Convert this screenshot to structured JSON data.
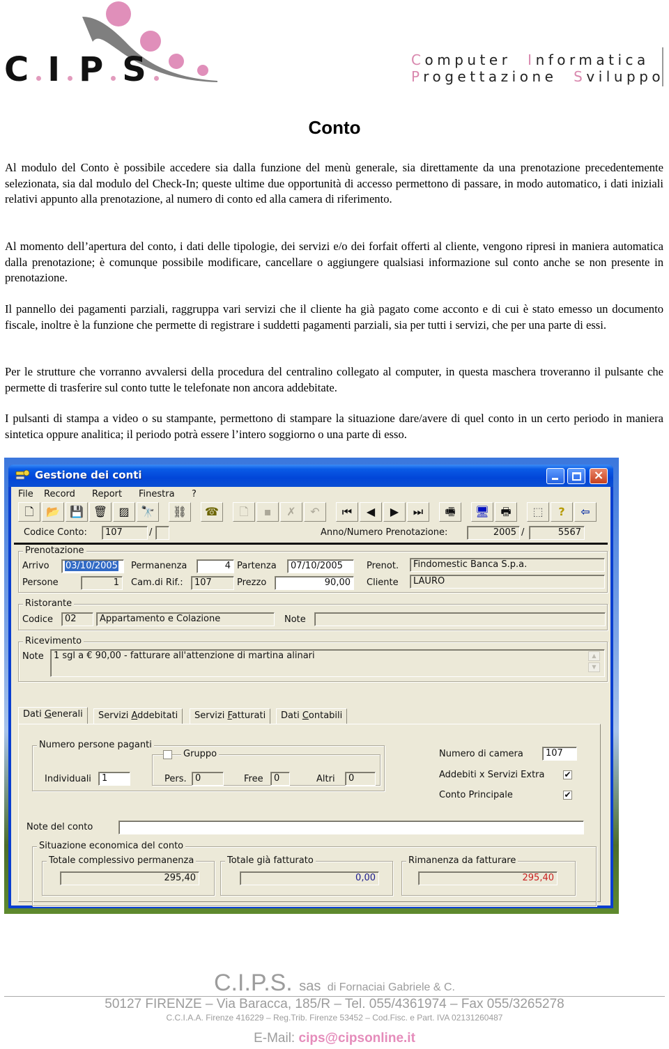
{
  "letterhead": {
    "logo_letters": [
      "C",
      "I",
      "P",
      "S"
    ],
    "tagline_line1": [
      {
        "cap": "C",
        "rest": "omputer"
      },
      {
        "cap": "I",
        "rest": "nformatica"
      }
    ],
    "tagline_line2": [
      {
        "cap": "P",
        "rest": "rogettazione"
      },
      {
        "cap": "S",
        "rest": "viluppo"
      }
    ],
    "brand_pink": "#d988ae"
  },
  "document": {
    "title": "Conto",
    "paragraphs": [
      "Al modulo del Conto è possibile accedere sia dalla funzione del menù generale, sia direttamente da una prenotazione precedentemente selezionata, sia dal modulo del Check-In; queste ultime due opportunità di accesso permettono di passare, in modo automatico, i dati iniziali relativi appunto alla prenotazione, al numero di conto ed alla camera di riferimento.",
      "Al momento dell’apertura del conto, i dati delle tipologie, dei servizi e/o dei forfait offerti al cliente, vengono ripresi in maniera automatica dalla prenotazione; è comunque possibile modificare, cancellare o aggiungere qualsiasi informazione sul conto anche se non presente in prenotazione.",
      "Il pannello dei pagamenti parziali, raggruppa vari servizi che il cliente ha già pagato come acconto e di cui è stato emesso un documento fiscale, inoltre è la funzione che permette di registrare i suddetti pagamenti parziali, sia per tutti i servizi, che per una parte di essi.",
      "Per le strutture che vorranno avvalersi della procedura del centralino collegato al computer,  in questa maschera troveranno il pulsante che permette di trasferire sul conto tutte le telefonate non ancora addebitate.",
      "I pulsanti di stampa a video o su stampante, permettono di stampare la situazione dare/avere di quel conto in un certo periodo in maniera sintetica oppure analitica; il periodo potrà essere l’intero soggiorno o una parte di esso."
    ]
  },
  "window": {
    "title": "Gestione dei conti",
    "controls": {
      "minimize": "minimize",
      "maximize": "maximize",
      "close": "×"
    },
    "menu": [
      "File",
      "Record",
      "Report",
      "Finestra",
      "?"
    ],
    "toolbar": [
      {
        "icon": "new-document-icon",
        "glyph": "🗋",
        "enabled": true
      },
      {
        "icon": "open-folder-icon",
        "glyph": "📂",
        "enabled": true
      },
      {
        "icon": "save-icon",
        "glyph": "💾",
        "enabled": true
      },
      {
        "icon": "trash-icon",
        "glyph": "🗑",
        "enabled": true
      },
      {
        "icon": "hatch-filter-icon",
        "glyph": "▨",
        "enabled": true
      },
      {
        "icon": "binoculars-icon",
        "glyph": "🔭",
        "enabled": true
      },
      {
        "icon": "unlink-chain-icon",
        "glyph": "⛓",
        "enabled": true
      },
      {
        "icon": "telephone-icon",
        "glyph": "☎",
        "enabled": true
      },
      {
        "icon": "new-line-icon",
        "glyph": "🗋",
        "enabled": false
      },
      {
        "icon": "save-line-icon",
        "glyph": "▪",
        "enabled": false
      },
      {
        "icon": "delete-line-icon",
        "glyph": "✗",
        "enabled": false
      },
      {
        "icon": "undo-line-icon",
        "glyph": "↶",
        "enabled": false
      },
      {
        "icon": "first-record-icon",
        "glyph": "⏮",
        "enabled": true
      },
      {
        "icon": "previous-record-icon",
        "glyph": "◀",
        "enabled": true
      },
      {
        "icon": "next-record-icon",
        "glyph": "▶",
        "enabled": true
      },
      {
        "icon": "last-record-icon",
        "glyph": "⏭",
        "enabled": true
      },
      {
        "icon": "fax-printer-icon",
        "glyph": "🖷",
        "enabled": true
      },
      {
        "icon": "monitor-icon",
        "glyph": "🖥",
        "enabled": true
      },
      {
        "icon": "printer-icon",
        "glyph": "🖶",
        "enabled": true
      },
      {
        "icon": "select-area-icon",
        "glyph": "⬚",
        "enabled": true
      },
      {
        "icon": "help-icon",
        "glyph": "?",
        "enabled": true
      },
      {
        "icon": "exit-door-icon",
        "glyph": "⇦",
        "enabled": true
      }
    ],
    "header": {
      "codice_conto_label": "Codice Conto:",
      "codice_conto_value": "107",
      "codice_conto_suffix": "",
      "slash": "/",
      "anno_label": "Anno/Numero Prenotazione:",
      "anno_value": "2005",
      "numero_value": "5567"
    },
    "prenotazione": {
      "title": "Prenotazione",
      "arrivo_label": "Arrivo",
      "arrivo_value": "03/10/2005",
      "permanenza_label": "Permanenza",
      "permanenza_value": "4",
      "partenza_label": "Partenza",
      "partenza_value": "07/10/2005",
      "prenot_label": "Prenot.",
      "prenot_value": "Findomestic Banca S.p.a.",
      "persone_label": "Persone",
      "persone_value": "1",
      "camera_label": "Cam.di Rif.:",
      "camera_value": "107",
      "prezzo_label": "Prezzo",
      "prezzo_value": "90,00",
      "cliente_label": "Cliente",
      "cliente_value": "LAURO"
    },
    "ristorante": {
      "title": "Ristorante",
      "codice_label": "Codice",
      "codice_value": "02",
      "descrizione_value": "Appartamento e Colazione",
      "note_label": "Note",
      "note_value": ""
    },
    "ricevimento": {
      "title": "Ricevimento",
      "note_label": "Note",
      "note_value": "1 sgl a € 90,00 - fatturare all'attenzione di martina alinari"
    },
    "tabs": [
      {
        "pre": "Dati ",
        "key": "G",
        "post": "enerali",
        "active": true
      },
      {
        "pre": "Servizi ",
        "key": "A",
        "post": "ddebitati",
        "active": false
      },
      {
        "pre": "Servizi ",
        "key": "F",
        "post": "atturati",
        "active": false
      },
      {
        "pre": "Dati ",
        "key": "C",
        "post": "ontabili",
        "active": false
      }
    ],
    "dati_generali": {
      "paganti_title": "Numero persone paganti",
      "individuali_label": "Individuali",
      "individuali_value": "1",
      "gruppo_label": "Gruppo",
      "gruppo_checked": false,
      "pers_label": "Pers.",
      "pers_value": "0",
      "free_label": "Free",
      "free_value": "0",
      "altri_label": "Altri",
      "altri_value": "0",
      "numero_camera_label": "Numero di camera",
      "numero_camera_value": "107",
      "addebiti_label": "Addebiti x Servizi Extra",
      "addebiti_checked": true,
      "conto_principale_label": "Conto Principale",
      "conto_principale_checked": true,
      "check_glyph": "✔",
      "note_conto_label": "Note del conto",
      "note_conto_value": "",
      "situazione_title": "Situazione economica del conto",
      "totale_permanenza_label": "Totale complessivo permanenza",
      "totale_permanenza_value": "295,40",
      "totale_fatturato_label": "Totale già fatturato",
      "totale_fatturato_value": "0,00",
      "rimanenza_label": "Rimanenza da fatturare",
      "rimanenza_value": "295,40",
      "fatturato_color": "#1a1a8c",
      "rimanenza_color": "#c81e1e"
    }
  },
  "footer": {
    "company": "C.I.P.S.",
    "sas": "sas",
    "owner": "di Fornaciai Gabriele & C.",
    "address": "50127 FIRENZE – Via Baracca, 185/R – Tel. 055/4361974 – Fax 055/3265278",
    "registry": "C.C.I.A.A. Firenze 416229 – Reg.Trib. Firenze 53452 – Cod.Fisc. e Part. IVA 02131260487",
    "email_label": "E-Mail:",
    "email": "cips@cipsonline.it"
  }
}
